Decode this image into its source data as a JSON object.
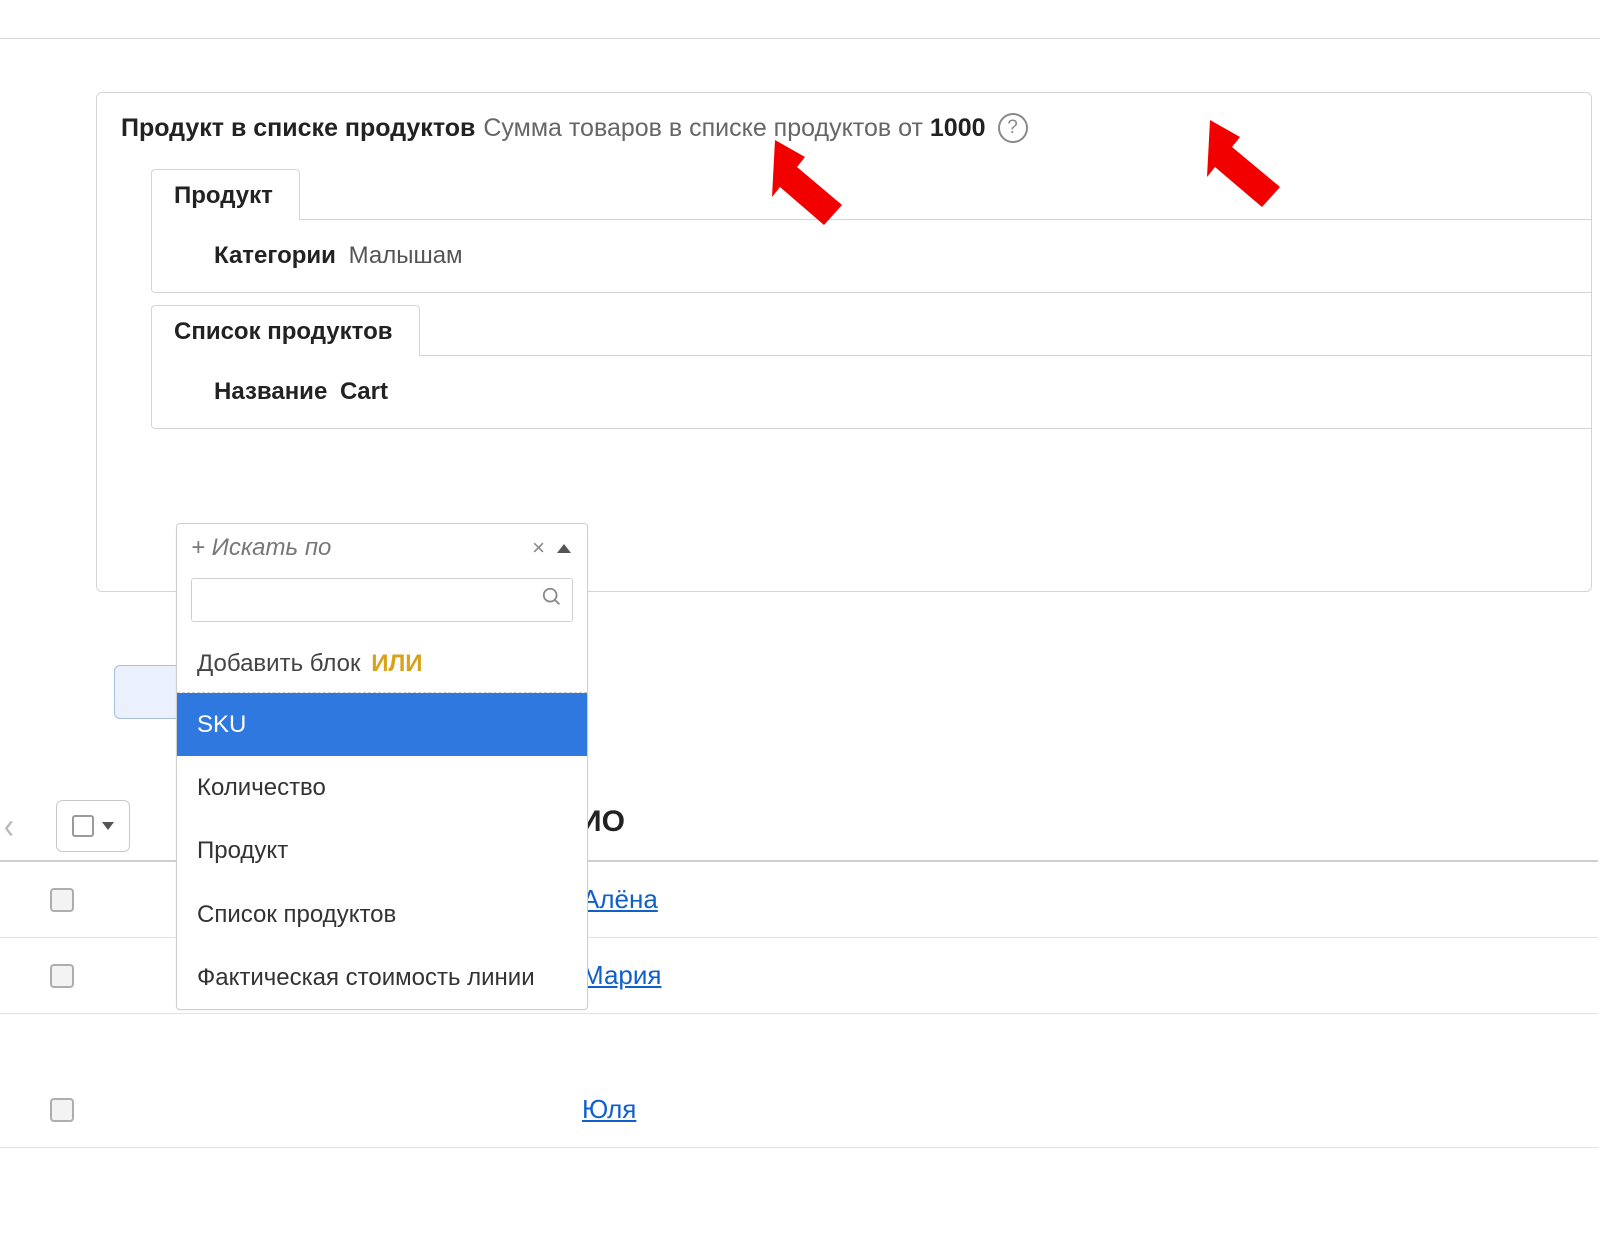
{
  "filter": {
    "title_prefix": "Продукт в списке продуктов",
    "title_mid": "Сумма товаров в списке продуктов от",
    "title_amount": "1000",
    "help_glyph": "?"
  },
  "section_product": {
    "tab_label": "Продукт",
    "field_label": "Категории",
    "field_value": "Малышам"
  },
  "section_list": {
    "tab_label": "Список продуктов",
    "field_label": "Название",
    "field_value": "Cart"
  },
  "search_by": {
    "placeholder": "+ Искать по",
    "clear_glyph": "×",
    "search_input_value": "",
    "add_or_prefix": "Добавить блок",
    "add_or_word": "ИЛИ",
    "items": [
      {
        "label": "SKU",
        "selected": true
      },
      {
        "label": "Количество",
        "selected": false
      },
      {
        "label": "Продукт",
        "selected": false
      },
      {
        "label": "Список продуктов",
        "selected": false
      },
      {
        "label": "Фактическая стоимость линии",
        "selected": false
      }
    ]
  },
  "toolbar": {
    "back_glyph": "‹",
    "header_fragment": "ИО"
  },
  "rows": [
    {
      "name": "Алёна"
    },
    {
      "name": "Мария"
    },
    {
      "name": "Юля"
    }
  ]
}
